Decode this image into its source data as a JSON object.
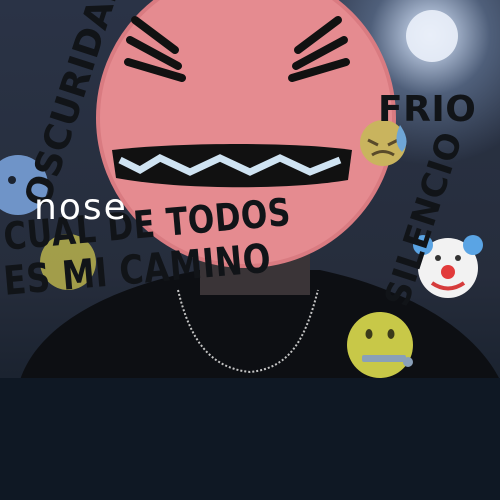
{
  "caption": {
    "text": "nose"
  },
  "overlay_text": {
    "oscuridad": "OSCURIDAD",
    "frio": "FRIO",
    "silencio": "SILENCIO",
    "cual": "CUAL DE TODOS",
    "mi_camino": "ES MI CAMINO"
  },
  "emojis": [
    "angry-face-emoji",
    "cold-sweat-face-emoji",
    "clown-face-emoji",
    "zipper-mouth-face-emoji",
    "blue-face-emoji",
    "yellow-face-emoji"
  ],
  "colors": {
    "angry_face": "#e58b90",
    "text_dark": "#111418",
    "caption": "#ffffff",
    "background": "#1b2330"
  }
}
